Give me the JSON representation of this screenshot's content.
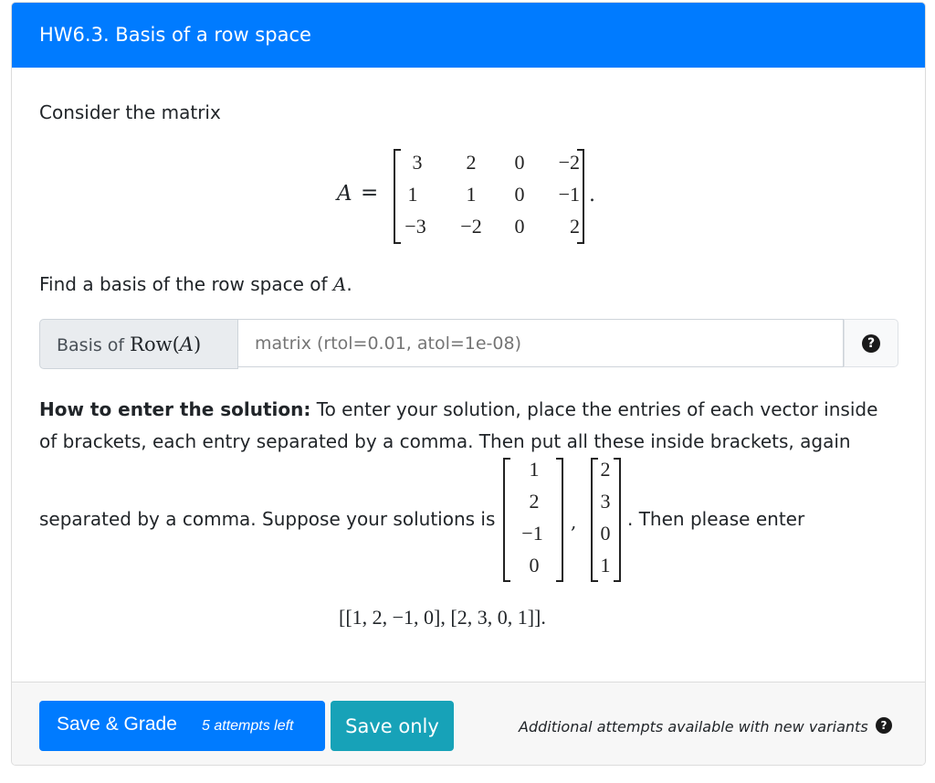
{
  "header": {
    "title": "HW6.3. Basis of a row space"
  },
  "question": {
    "intro": "Consider the matrix",
    "matrix_name": "A",
    "equals": "=",
    "matrix_rows": [
      [
        "3",
        "2",
        "0",
        "−2"
      ],
      [
        "1",
        "1",
        "0",
        "−1"
      ],
      [
        "−3",
        "−2",
        "0",
        "2"
      ]
    ],
    "period": ".",
    "prompt_prefix": "Find a basis of the row space of ",
    "prompt_var": "A",
    "prompt_suffix": "."
  },
  "answer_input": {
    "label_text": "Basis of ",
    "label_math": "Row(",
    "label_var": "A",
    "label_close": ")",
    "placeholder": "matrix (rtol=0.01, atol=1e-08)",
    "value": "",
    "help_icon": "question-circle-icon"
  },
  "instructions": {
    "bold_lead": "How to enter the solution:",
    "line1": " To enter your solution, place the entries of each vector inside",
    "line2": "of brackets, each entry separated by a comma. Then put all these inside brackets, again",
    "line3_prefix": "separated by a comma. Suppose your solutions is",
    "vector1": [
      "1",
      "2",
      "−1",
      "0"
    ],
    "comma": ",",
    "vector2": [
      "2",
      "3",
      "0",
      "1"
    ],
    "line3_suffix": ". Then please enter",
    "example": "[[1, 2, −1, 0], [2, 3, 0, 1]]."
  },
  "footer": {
    "grade_button": "Save & Grade",
    "attempts_left": "5 attempts left",
    "save_button": "Save only",
    "note": "Additional attempts available with new variants",
    "note_icon": "question-circle-icon"
  },
  "colors": {
    "primary": "#007bff",
    "info": "#17a2b8"
  }
}
